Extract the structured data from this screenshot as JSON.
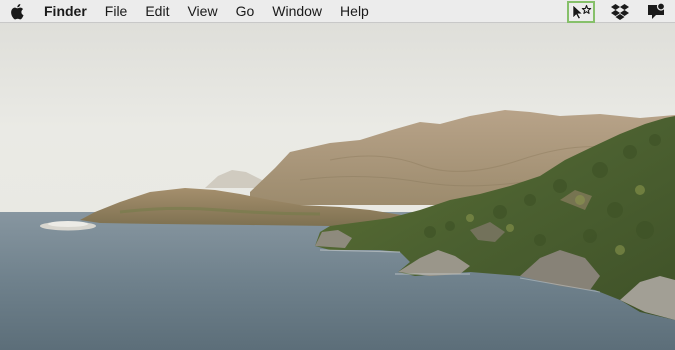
{
  "menubar": {
    "apple_icon": "apple-logo-icon",
    "app_name": "Finder",
    "menus": [
      "File",
      "Edit",
      "View",
      "Go",
      "Window",
      "Help"
    ]
  },
  "status_icons": [
    {
      "name": "cursor-star-icon",
      "highlighted": true
    },
    {
      "name": "dropbox-icon",
      "highlighted": false
    },
    {
      "name": "notification-badge-icon",
      "highlighted": false
    }
  ],
  "wallpaper": {
    "scene": "coastal-headland",
    "colors": {
      "sky": "#e8e7e1",
      "sea": "#6f7f8a",
      "land": "#8f7a5c",
      "vegetation": "#4f6a32",
      "highlight": "#86c06a"
    }
  }
}
